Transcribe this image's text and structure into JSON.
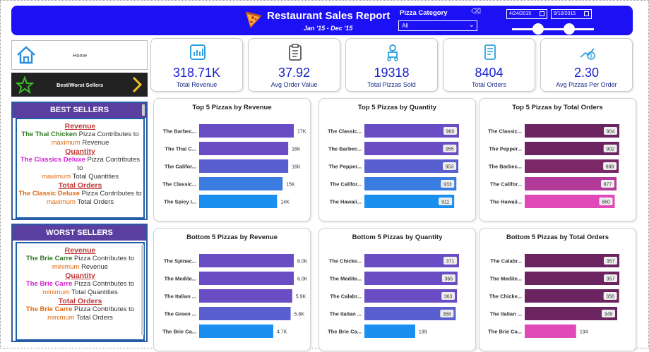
{
  "header": {
    "title": "Restaurant Sales Report",
    "subtitle": "Jan '15 - Dec '15",
    "category_label": "Pizza Category",
    "category_value": "All",
    "date_start": "4/24/2015",
    "date_end": "9/10/2015"
  },
  "nav": {
    "home_label": "Home",
    "best_worst_label": "Best/Worst Sellers"
  },
  "best": {
    "heading": "BEST SELLERS",
    "revenue_title": "Revenue",
    "revenue_pizza": "The Thai Chicken",
    "revenue_mid": "Pizza Contributes to",
    "revenue_emph": "maximum",
    "revenue_tail": "Revenue",
    "quantity_title": "Quantity",
    "quantity_pizza": "The Classics Deluxe",
    "quantity_mid": "Pizza Contributes to",
    "quantity_emph": "maximum",
    "quantity_tail": "Total Quantities",
    "orders_title": "Total Orders",
    "orders_pizza": "The Classic Deluxe",
    "orders_mid": "Pizza Contributes to",
    "orders_emph": "maximum",
    "orders_tail": "Total Orders"
  },
  "worst": {
    "heading": "WORST SELLERS",
    "revenue_title": "Revenue",
    "revenue_pizza": "The Brie Carre",
    "revenue_mid": "Pizza Contributes to",
    "revenue_emph": "minimum",
    "revenue_tail": "Revenue",
    "quantity_title": "Quantity",
    "quantity_pizza": "The Brie Carre",
    "quantity_mid": "Pizza Contributes to",
    "quantity_emph": "minimum",
    "quantity_tail": "Total Quantities",
    "orders_title": "Total Orders",
    "orders_pizza": "The Brie Carre",
    "orders_mid": "Pizza Contributes to",
    "orders_emph": "minimum",
    "orders_tail": "Total Orders"
  },
  "kpis": [
    {
      "value": "318.71K",
      "label": "Total Revenue",
      "icon": "chart-icon"
    },
    {
      "value": "37.92",
      "label": "Avg Order Value",
      "icon": "clipboard-icon"
    },
    {
      "value": "19318",
      "label": "Total Pizzas Sold",
      "icon": "delivery-icon"
    },
    {
      "value": "8404",
      "label": "Total Orders",
      "icon": "receipt-icon"
    },
    {
      "value": "2.30",
      "label": "Avg Pizzas Per Order",
      "icon": "money-icon"
    }
  ],
  "chart_data": [
    {
      "type": "bar",
      "title": "Top 5 Pizzas by Revenue",
      "categories": [
        "The Barbec...",
        "The Thai C...",
        "The Califor...",
        "The Classic...",
        "The Spicy I..."
      ],
      "values": [
        17000,
        16000,
        16000,
        15000,
        14000
      ],
      "labels": [
        "17K",
        "16K",
        "16K",
        "15K",
        "14K"
      ],
      "colors": [
        "#6a4cc4",
        "#6a4cc4",
        "#5a5fd0",
        "#3b7ce0",
        "#1a8ff0"
      ],
      "boxed": false
    },
    {
      "type": "bar",
      "title": "Top 5 Pizzas by Quantity",
      "categories": [
        "The Classic...",
        "The Barbec...",
        "The Pepper...",
        "The Califor...",
        "The Hawaii..."
      ],
      "values": [
        960,
        955,
        953,
        933,
        911
      ],
      "labels": [
        "960",
        "955",
        "953",
        "933",
        "911"
      ],
      "colors": [
        "#6a4cc4",
        "#6a4cc4",
        "#5a5fd0",
        "#3b7ce0",
        "#1a8ff0"
      ],
      "boxed": true
    },
    {
      "type": "bar",
      "title": "Top 5 Pizzas by Total Orders",
      "categories": [
        "The Classic...",
        "The Pepper...",
        "The Barbec...",
        "The Califor...",
        "The Hawaii..."
      ],
      "values": [
        904,
        902,
        898,
        877,
        860
      ],
      "labels": [
        "904",
        "902",
        "898",
        "877",
        "860"
      ],
      "colors": [
        "#6b2460",
        "#6b2460",
        "#7a2868",
        "#b23a98",
        "#e04ab8"
      ],
      "boxed": true
    },
    {
      "type": "bar",
      "title": "Bottom 5 Pizzas by Revenue",
      "categories": [
        "The Spinac...",
        "The Medite...",
        "The Italian ...",
        "The Green ...",
        "The Brie Ca..."
      ],
      "values": [
        6000,
        6000,
        5900,
        5800,
        4700
      ],
      "labels": [
        "6.0K",
        "6.0K",
        "5.9K",
        "5.8K",
        "4.7K"
      ],
      "colors": [
        "#6a4cc4",
        "#6a4cc4",
        "#6a4cc4",
        "#5a5fd0",
        "#1a8ff0"
      ],
      "boxed": false
    },
    {
      "type": "bar",
      "title": "Bottom 5 Pizzas by Quantity",
      "categories": [
        "The Chicke...",
        "The Medite...",
        "The Calabr...",
        "The Italian ...",
        "The Brie Ca..."
      ],
      "values": [
        371,
        365,
        363,
        358,
        199
      ],
      "labels": [
        "371",
        "365",
        "363",
        "358",
        "199"
      ],
      "colors": [
        "#6a4cc4",
        "#6a4cc4",
        "#6a4cc4",
        "#5a5fd0",
        "#1a8ff0"
      ],
      "boxed": true
    },
    {
      "type": "bar",
      "title": "Bottom 5 Pizzas by Total Orders",
      "categories": [
        "The Calabr...",
        "The Medite...",
        "The Chicke...",
        "The Italian ...",
        "The Brie Ca..."
      ],
      "values": [
        357,
        357,
        356,
        349,
        194
      ],
      "labels": [
        "357",
        "357",
        "356",
        "349",
        "194"
      ],
      "colors": [
        "#6b2460",
        "#6b2460",
        "#6b2460",
        "#6b2460",
        "#e04ab8"
      ],
      "boxed": true
    }
  ]
}
